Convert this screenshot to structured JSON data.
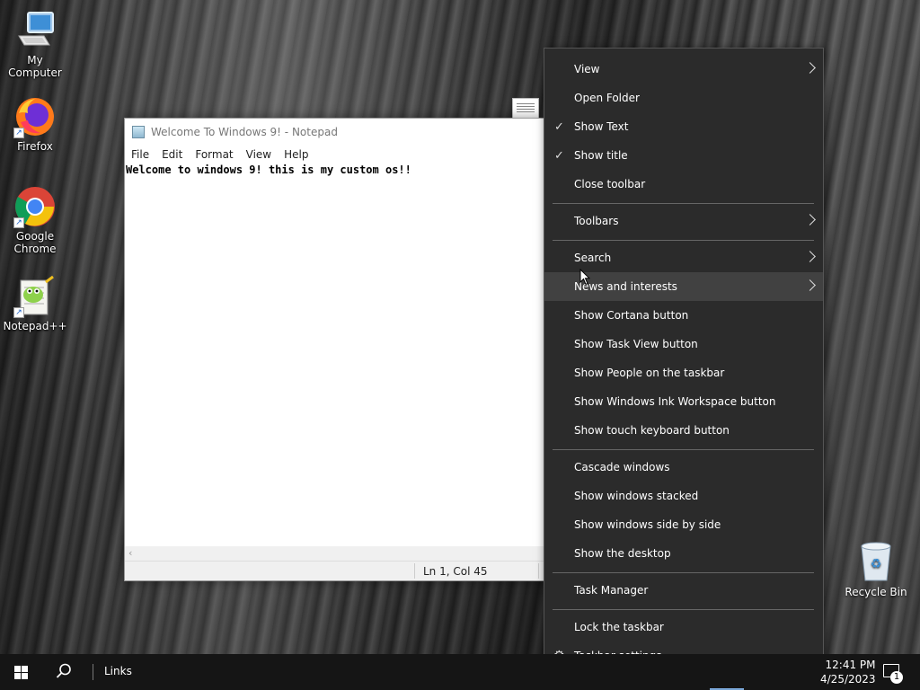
{
  "desktop": {
    "icons": [
      {
        "label": "My Computer"
      },
      {
        "label": "Firefox"
      },
      {
        "label": "Google Chrome"
      },
      {
        "label": "Notepad++"
      }
    ],
    "recycle_bin": {
      "label": "Recycle Bin"
    }
  },
  "notepad": {
    "title": "Welcome To Windows 9! - Notepad",
    "menu": [
      "File",
      "Edit",
      "Format",
      "View",
      "Help"
    ],
    "content": "Welcome to windows 9! this is my custom os!!",
    "status_position": "Ln 1, Col 45"
  },
  "context_menu": {
    "items": [
      {
        "label": "View",
        "submenu": true
      },
      {
        "label": "Open Folder"
      },
      {
        "label": "Show Text",
        "checked": true
      },
      {
        "label": "Show title",
        "checked": true
      },
      {
        "label": "Close toolbar"
      },
      {
        "label": "Toolbars",
        "submenu": true
      },
      {
        "label": "Search",
        "submenu": true
      },
      {
        "label": "News and interests",
        "submenu": true,
        "highlighted": true
      },
      {
        "label": "Show Cortana button"
      },
      {
        "label": "Show Task View button"
      },
      {
        "label": "Show People on the taskbar"
      },
      {
        "label": "Show Windows Ink Workspace button"
      },
      {
        "label": "Show touch keyboard button"
      },
      {
        "label": "Cascade windows"
      },
      {
        "label": "Show windows stacked"
      },
      {
        "label": "Show windows side by side"
      },
      {
        "label": "Show the desktop"
      },
      {
        "label": "Task Manager"
      },
      {
        "label": "Lock the taskbar"
      },
      {
        "label": "Taskbar settings"
      }
    ]
  },
  "taskbar": {
    "links_label": "Links",
    "time": "12:41 PM",
    "date": "4/25/2023",
    "notification_count": "1"
  }
}
